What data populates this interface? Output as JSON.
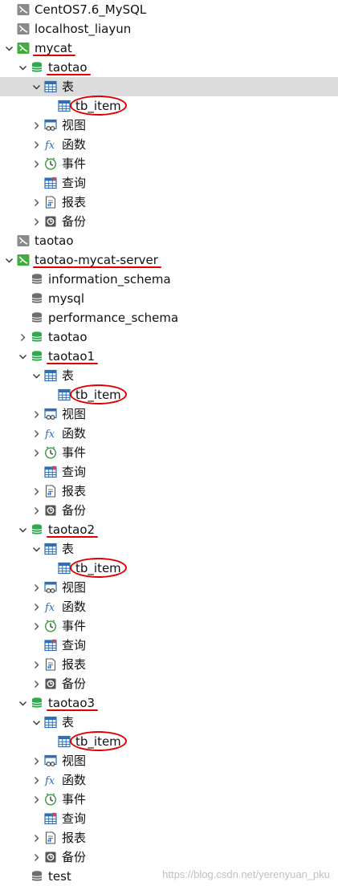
{
  "tree": {
    "connections": {
      "centos": "CentOS7.6_MySQL",
      "localhost": "localhost_liayun",
      "mycat": "mycat",
      "taotao_conn": "taotao",
      "mycat_server": "taotao-mycat-server"
    },
    "databases": {
      "taotao": "taotao",
      "information_schema": "information_schema",
      "mysql": "mysql",
      "performance_schema": "performance_schema",
      "taotao_plain": "taotao",
      "taotao1": "taotao1",
      "taotao2": "taotao2",
      "taotao3": "taotao3",
      "test": "test"
    },
    "nodes": {
      "tables": "表",
      "views": "视图",
      "functions": "函数",
      "events": "事件",
      "queries": "查询",
      "reports": "报表",
      "backups": "备份",
      "table_tb_item": "tb_item"
    },
    "colors": {
      "selected_row": "#dcdcdc",
      "annotation_red": "#e00000",
      "db_green": "#2fa84f",
      "conn_green": "#3fae3c",
      "conn_gray": "#8a8a8a",
      "table_blue": "#2f6fb5"
    }
  },
  "watermark": "https://blog.csdn.net/yerenyuan_pku"
}
